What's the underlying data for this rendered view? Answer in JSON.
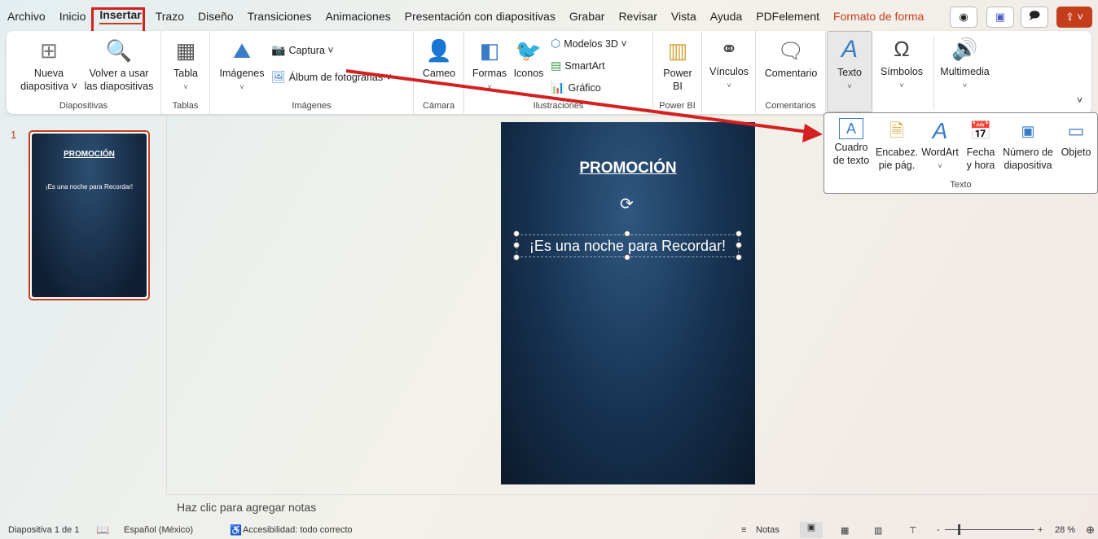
{
  "menu": {
    "tabs": [
      "Archivo",
      "Inicio",
      "Insertar",
      "Trazo",
      "Diseño",
      "Transiciones",
      "Animaciones",
      "Presentación con diapositivas",
      "Grabar",
      "Revisar",
      "Vista",
      "Ayuda",
      "PDFelement"
    ],
    "context_tab": "Formato de forma"
  },
  "ribbon": {
    "diapositivas": {
      "label": "Diapositivas",
      "nueva": [
        "Nueva",
        "diapositiva ˅"
      ],
      "volver": [
        "Volver a usar",
        "las diapositivas"
      ]
    },
    "tablas": {
      "label": "Tablas",
      "tabla": "Tabla"
    },
    "imagenes": {
      "label": "Imágenes",
      "imagenes": "Imágenes",
      "captura": "Captura ˅",
      "album": "Álbum de fotografías ˅"
    },
    "camara": {
      "label": "Cámara",
      "cameo": "Cameo"
    },
    "ilustraciones": {
      "label": "Ilustraciones",
      "formas": "Formas",
      "iconos": "Iconos",
      "modelos": "Modelos 3D ˅",
      "smartart": "SmartArt",
      "grafico": "Gráfico"
    },
    "powerbi": {
      "label": "Power BI",
      "btn": [
        "Power",
        "BI"
      ]
    },
    "vinculos": {
      "btn": "Vínculos"
    },
    "comentarios": {
      "label": "Comentarios",
      "btn": "Comentario"
    },
    "texto": {
      "btn": "Texto"
    },
    "simbolos": {
      "btn": "Símbolos"
    },
    "multimedia": {
      "btn": "Multimedia"
    }
  },
  "texto_dropdown": {
    "label": "Texto",
    "items": [
      [
        "Cuadro",
        "de texto"
      ],
      [
        "Encabez.",
        "pie pág."
      ],
      [
        "WordArt",
        "˅"
      ],
      [
        "Fecha",
        "y hora"
      ],
      [
        "Número de",
        "diapositiva"
      ],
      [
        "Objeto",
        ""
      ]
    ]
  },
  "thumbnail": {
    "number": "1",
    "title": "PROMOCIÓN",
    "subtitle": "¡Es una noche para Recordar!"
  },
  "slide": {
    "title": "PROMOCIÓN",
    "text": "¡Es una noche para Recordar!"
  },
  "notes": {
    "placeholder": "Haz clic para agregar notas"
  },
  "status": {
    "slide": "Diapositiva 1 de 1",
    "language": "Español (México)",
    "accessibility": "Accesibilidad: todo correcto",
    "notes": "Notas",
    "zoom": "28 %"
  },
  "colors": {
    "accent": "#c43e1c",
    "highlight": "#d42020"
  }
}
